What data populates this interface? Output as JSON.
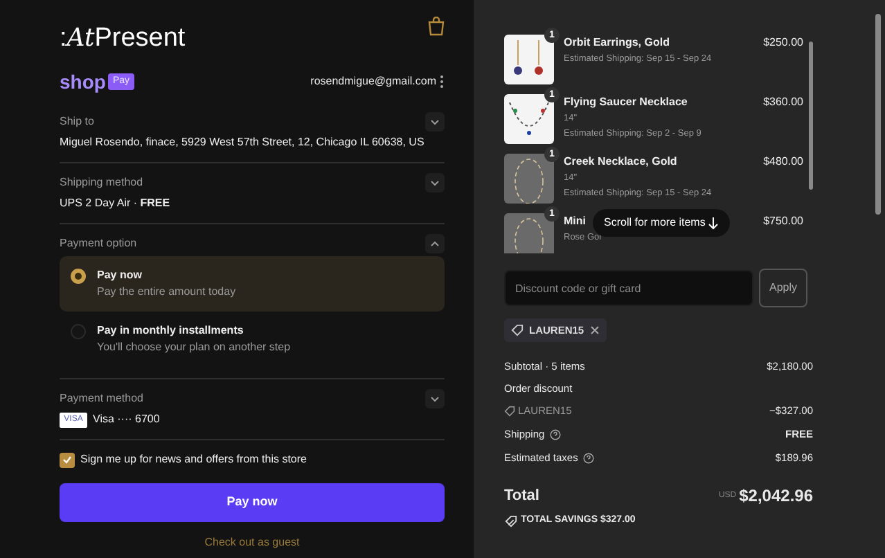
{
  "brand": {
    "logo_mark": ":",
    "logo_italic": "At",
    "logo_text": "Present"
  },
  "shop_pay": {
    "word": "shop",
    "badge": "Pay",
    "email": "rosendmigue@gmail.com"
  },
  "sections": [
    {
      "kind": "text",
      "label": "Ship to",
      "value": "Miguel Rosendo, finace, 5929 West 57th Street, 12, Chicago IL 60638, US",
      "expanded": false
    },
    {
      "kind": "text",
      "label": "Shipping method",
      "value": "UPS 2 Day Air · **FREE**",
      "expanded": false
    },
    {
      "kind": "options",
      "label": "Payment option",
      "expanded": true,
      "options": [
        {
          "title": "Pay now",
          "subtitle": "Pay the entire amount today",
          "selected": true
        },
        {
          "title": "Pay in monthly installments",
          "subtitle": "You'll choose your plan on another step",
          "selected": false
        }
      ]
    },
    {
      "kind": "card",
      "label": "Payment method",
      "card_logo": "VISA",
      "value": "Visa ···· 6700",
      "expanded": false
    }
  ],
  "newsletter": {
    "label": "Sign me up for news and offers from this store",
    "checked": true
  },
  "pay_button": "Pay now",
  "guest_link": "Check out as guest",
  "items": [
    {
      "qty": "1",
      "name": "Orbit Earrings, Gold",
      "shipping": "Estimated Shipping: Sep 15 - Sep 24",
      "price": "$250.00"
    },
    {
      "qty": "1",
      "name": "Flying Saucer Necklace",
      "variant": "14\"",
      "shipping": "Estimated Shipping: Sep 2 - Sep 9",
      "price": "$360.00"
    },
    {
      "qty": "1",
      "name": "Creek Necklace, Gold",
      "variant": "14\"",
      "shipping": "Estimated Shipping: Sep 15 - Sep 24",
      "price": "$480.00"
    },
    {
      "qty": "1",
      "name": "Mini",
      "variant": "Rose Gol",
      "price": "$750.00"
    }
  ],
  "scroll_hint": "Scroll for more items",
  "discount": {
    "placeholder": "Discount code or gift card",
    "button": "Apply",
    "tag": "LAUREN15"
  },
  "summary": [
    {
      "kind": "row",
      "label": "Subtotal · 5 items",
      "value": "$2,180.00",
      "help": false
    },
    {
      "kind": "heading",
      "label": "Order discount"
    },
    {
      "kind": "code",
      "label": "LAUREN15",
      "value": "−$327.00"
    },
    {
      "kind": "row",
      "label": "Shipping",
      "value": "FREE",
      "help": true
    },
    {
      "kind": "row",
      "label": "Estimated taxes",
      "value": "$189.96",
      "help": true
    }
  ],
  "total": {
    "label": "Total",
    "currency": "USD",
    "amount": "$2,042.96"
  },
  "savings": {
    "label": "TOTAL SAVINGS",
    "amount": "$327.00"
  }
}
